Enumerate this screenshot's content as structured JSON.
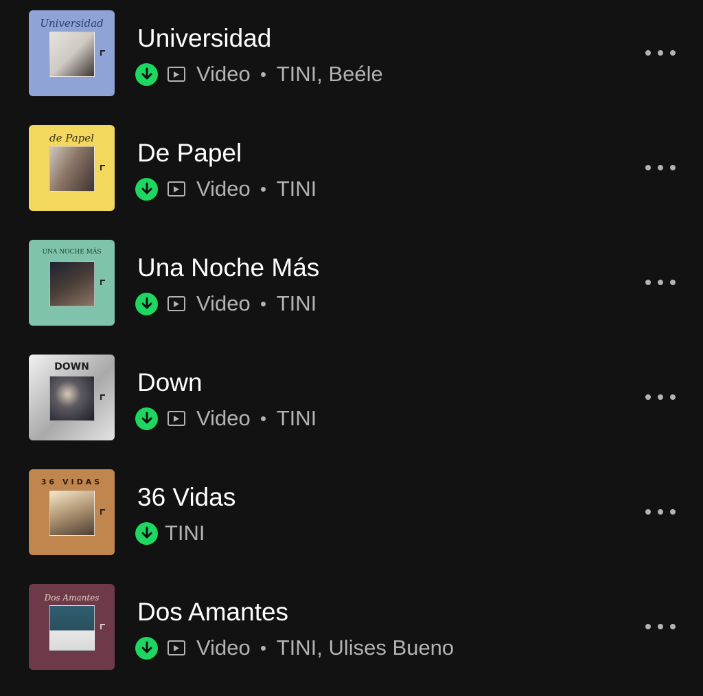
{
  "colors": {
    "background": "#121212",
    "title": "#ffffff",
    "secondary": "#b3b3b3",
    "download_accent": "#1ed760"
  },
  "tracks": [
    {
      "title": "Universidad",
      "has_video": true,
      "video_label": "Video",
      "artists": "TINI, Beéle",
      "downloaded": true,
      "cover": {
        "text": "Universidad",
        "bg": "#8fa3d6",
        "photo": "#d9d6d0"
      }
    },
    {
      "title": "De Papel",
      "has_video": true,
      "video_label": "Video",
      "artists": "TINI",
      "downloaded": true,
      "cover": {
        "text": "de Papel",
        "bg": "#f4d85e",
        "photo": "#7e6a5f"
      }
    },
    {
      "title": "Una Noche Más",
      "has_video": true,
      "video_label": "Video",
      "artists": "TINI",
      "downloaded": true,
      "cover": {
        "text": "UNA NOCHE MÁS",
        "bg": "#7fc4aa",
        "photo": "#3a3634"
      }
    },
    {
      "title": "Down",
      "has_video": true,
      "video_label": "Video",
      "artists": "TINI",
      "downloaded": true,
      "cover": {
        "text": "DOWN",
        "bg": "#cfcfcf",
        "photo": "#2a2d35"
      }
    },
    {
      "title": "36 Vidas",
      "has_video": false,
      "video_label": "",
      "artists": "TINI",
      "downloaded": true,
      "cover": {
        "text": "36 VIDAS",
        "bg": "#c0864d",
        "photo": "#a49378"
      }
    },
    {
      "title": "Dos Amantes",
      "has_video": true,
      "video_label": "Video",
      "artists": "TINI, Ulises Bueno",
      "downloaded": true,
      "cover": {
        "text": "Dos Amantes",
        "bg": "#6e3a4a",
        "photo": "#2d5566"
      }
    }
  ]
}
